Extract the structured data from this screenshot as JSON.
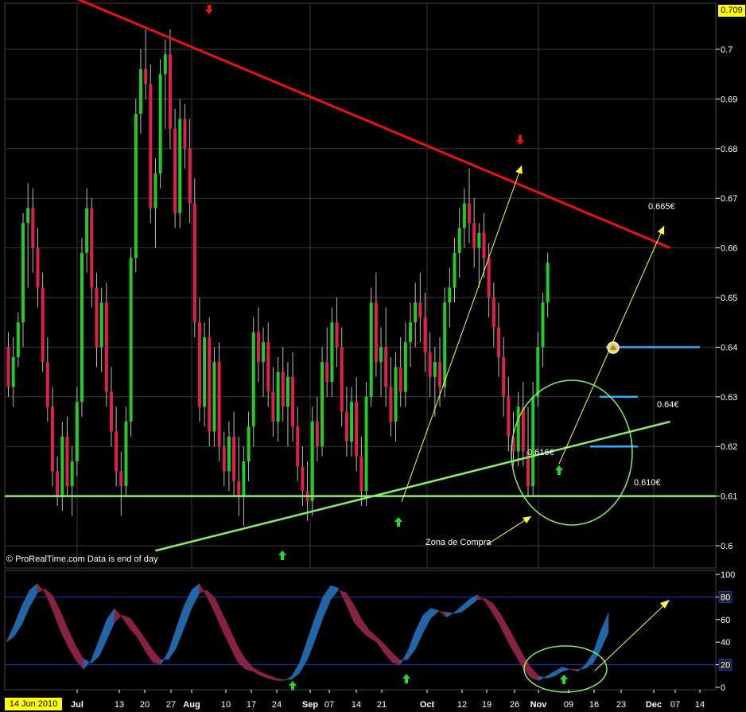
{
  "watermark": "© ProRealTime.com  Data is end of day",
  "last_price_badge": "0.709",
  "start_date_badge": "14 Jun 2010",
  "colors": {
    "background": "#000000",
    "up_candle": "#22cc22",
    "down_candle": "#e0204a",
    "resistance_line": "#ee1111",
    "support_line": "#88ee66",
    "projection_arrow": "#ffff33",
    "level_marker": "#33aaff",
    "green_arrow": "#22dd22",
    "red_arrow": "#ee1111",
    "badge_yellow": "#ffff00",
    "badge_green": "#00ff66",
    "osc_blue": "#2266aa",
    "osc_maroon": "#882244"
  },
  "annotations": {
    "target_price": "0.665€",
    "level_064": "0.64€",
    "level_0616": "0.616€",
    "level_0610": "0.610€",
    "buy_zone": "Zona de Compra"
  },
  "chart_data": [
    {
      "type": "candlestick",
      "title": "",
      "ylim": [
        0.597,
        0.712
      ],
      "y_ticks": [
        "0.6",
        "0.61",
        "0.62",
        "0.63",
        "0.64",
        "0.65",
        "0.66",
        "0.67",
        "0.68",
        "0.69",
        "0.7"
      ],
      "x_ticks": [
        "Jul",
        "13",
        "20",
        "27",
        "Aug",
        "10",
        "17",
        "24",
        "Sep",
        "07",
        "14",
        "21",
        "Oct",
        "12",
        "19",
        "26",
        "Nov",
        "09",
        "16",
        "23",
        "Dec",
        "07",
        "14"
      ],
      "grid": true,
      "series": [
        {
          "name": "",
          "period": "Jun 14 – Jul 02",
          "ohlc": [
            [
              0.64,
              0.643,
              0.63,
              0.632
            ],
            [
              0.632,
              0.642,
              0.628,
              0.638
            ],
            [
              0.638,
              0.647,
              0.636,
              0.645
            ],
            [
              0.645,
              0.667,
              0.64,
              0.665
            ],
            [
              0.665,
              0.673,
              0.652,
              0.668
            ],
            [
              0.668,
              0.672,
              0.655,
              0.66
            ],
            [
              0.66,
              0.664,
              0.648,
              0.652
            ],
            [
              0.652,
              0.655,
              0.635,
              0.637
            ],
            [
              0.637,
              0.642,
              0.625,
              0.628
            ],
            [
              0.628,
              0.632,
              0.612,
              0.615
            ],
            [
              0.615,
              0.618,
              0.608,
              0.61
            ],
            [
              0.61,
              0.625,
              0.607,
              0.622
            ],
            [
              0.622,
              0.626,
              0.61,
              0.612
            ],
            [
              0.612,
              0.62,
              0.606,
              0.617
            ],
            [
              0.617,
              0.632,
              0.614,
              0.629
            ]
          ]
        },
        {
          "name": "",
          "period": "Jul 05 – Jul 30",
          "ohlc": [
            [
              0.629,
              0.662,
              0.626,
              0.659
            ],
            [
              0.659,
              0.672,
              0.655,
              0.668
            ],
            [
              0.668,
              0.67,
              0.648,
              0.652
            ],
            [
              0.652,
              0.655,
              0.636,
              0.64
            ],
            [
              0.64,
              0.652,
              0.635,
              0.649
            ],
            [
              0.649,
              0.653,
              0.628,
              0.631
            ],
            [
              0.631,
              0.636,
              0.62,
              0.623
            ],
            [
              0.623,
              0.628,
              0.612,
              0.615
            ],
            [
              0.615,
              0.619,
              0.606,
              0.612
            ],
            [
              0.612,
              0.628,
              0.61,
              0.625
            ],
            [
              0.625,
              0.66,
              0.622,
              0.658
            ],
            [
              0.658,
              0.69,
              0.655,
              0.687
            ],
            [
              0.687,
              0.7,
              0.683,
              0.696
            ],
            [
              0.696,
              0.704,
              0.69,
              0.693
            ],
            [
              0.693,
              0.697,
              0.665,
              0.668
            ],
            [
              0.668,
              0.678,
              0.66,
              0.675
            ],
            [
              0.675,
              0.698,
              0.672,
              0.695
            ],
            [
              0.695,
              0.702,
              0.684,
              0.699
            ],
            [
              0.699,
              0.704,
              0.68,
              0.684
            ],
            [
              0.684,
              0.688,
              0.664,
              0.667
            ]
          ]
        },
        {
          "name": "",
          "period": "Aug 02 – Aug 27",
          "ohlc": [
            [
              0.667,
              0.69,
              0.664,
              0.686
            ],
            [
              0.686,
              0.689,
              0.676,
              0.68
            ],
            [
              0.68,
              0.686,
              0.665,
              0.669
            ],
            [
              0.669,
              0.674,
              0.642,
              0.645
            ],
            [
              0.645,
              0.65,
              0.625,
              0.628
            ],
            [
              0.628,
              0.645,
              0.624,
              0.642
            ],
            [
              0.642,
              0.646,
              0.62,
              0.623
            ],
            [
              0.623,
              0.64,
              0.62,
              0.637
            ],
            [
              0.637,
              0.641,
              0.617,
              0.62
            ],
            [
              0.62,
              0.623,
              0.612,
              0.615
            ],
            [
              0.615,
              0.625,
              0.611,
              0.622
            ],
            [
              0.622,
              0.627,
              0.61,
              0.613
            ],
            [
              0.613,
              0.622,
              0.606,
              0.61
            ],
            [
              0.61,
              0.62,
              0.604,
              0.617
            ],
            [
              0.617,
              0.627,
              0.613,
              0.624
            ],
            [
              0.624,
              0.646,
              0.62,
              0.643
            ],
            [
              0.643,
              0.648,
              0.633,
              0.637
            ],
            [
              0.637,
              0.644,
              0.63,
              0.641
            ],
            [
              0.641,
              0.645,
              0.628,
              0.631
            ],
            [
              0.631,
              0.636,
              0.622,
              0.625
            ]
          ]
        },
        {
          "name": "",
          "period": "Aug 30 – Sep 24",
          "ohlc": [
            [
              0.625,
              0.638,
              0.621,
              0.635
            ],
            [
              0.635,
              0.64,
              0.625,
              0.628
            ],
            [
              0.628,
              0.637,
              0.62,
              0.634
            ],
            [
              0.634,
              0.639,
              0.621,
              0.624
            ],
            [
              0.624,
              0.628,
              0.613,
              0.616
            ],
            [
              0.616,
              0.62,
              0.608,
              0.611
            ],
            [
              0.611,
              0.617,
              0.605,
              0.609
            ],
            [
              0.609,
              0.628,
              0.606,
              0.625
            ],
            [
              0.625,
              0.63,
              0.617,
              0.62
            ],
            [
              0.62,
              0.64,
              0.618,
              0.637
            ],
            [
              0.637,
              0.644,
              0.63,
              0.633
            ],
            [
              0.633,
              0.648,
              0.63,
              0.645
            ],
            [
              0.645,
              0.65,
              0.636,
              0.64
            ],
            [
              0.64,
              0.644,
              0.624,
              0.627
            ],
            [
              0.627,
              0.632,
              0.618,
              0.621
            ],
            [
              0.621,
              0.632,
              0.618,
              0.629
            ],
            [
              0.629,
              0.634,
              0.615,
              0.618
            ],
            [
              0.618,
              0.622,
              0.608,
              0.611
            ],
            [
              0.611,
              0.633,
              0.608,
              0.63
            ],
            [
              0.63,
              0.652,
              0.628,
              0.649
            ]
          ]
        },
        {
          "name": "",
          "period": "Sep 27 – Oct 22",
          "ohlc": [
            [
              0.649,
              0.655,
              0.634,
              0.637
            ],
            [
              0.637,
              0.644,
              0.63,
              0.64
            ],
            [
              0.64,
              0.648,
              0.628,
              0.632
            ],
            [
              0.632,
              0.638,
              0.622,
              0.625
            ],
            [
              0.625,
              0.639,
              0.621,
              0.636
            ],
            [
              0.636,
              0.642,
              0.628,
              0.631
            ],
            [
              0.631,
              0.645,
              0.628,
              0.641
            ],
            [
              0.641,
              0.649,
              0.636,
              0.645
            ],
            [
              0.645,
              0.653,
              0.64,
              0.649
            ],
            [
              0.649,
              0.655,
              0.641,
              0.646
            ],
            [
              0.646,
              0.651,
              0.635,
              0.639
            ],
            [
              0.639,
              0.643,
              0.63,
              0.634
            ],
            [
              0.634,
              0.64,
              0.626,
              0.637
            ],
            [
              0.637,
              0.642,
              0.628,
              0.632
            ],
            [
              0.632,
              0.652,
              0.63,
              0.649
            ],
            [
              0.649,
              0.656,
              0.644,
              0.652
            ],
            [
              0.652,
              0.662,
              0.649,
              0.659
            ],
            [
              0.659,
              0.668,
              0.654,
              0.664
            ],
            [
              0.664,
              0.672,
              0.66,
              0.669
            ],
            [
              0.669,
              0.676,
              0.661,
              0.665
            ]
          ]
        },
        {
          "name": "",
          "period": "Oct 25 – Nov 19",
          "ohlc": [
            [
              0.665,
              0.67,
              0.656,
              0.66
            ],
            [
              0.66,
              0.665,
              0.652,
              0.663
            ],
            [
              0.663,
              0.667,
              0.654,
              0.658
            ],
            [
              0.658,
              0.661,
              0.646,
              0.65
            ],
            [
              0.65,
              0.653,
              0.64,
              0.644
            ],
            [
              0.644,
              0.649,
              0.634,
              0.638
            ],
            [
              0.638,
              0.642,
              0.626,
              0.63
            ],
            [
              0.63,
              0.634,
              0.619,
              0.622
            ],
            [
              0.622,
              0.627,
              0.616,
              0.619
            ],
            [
              0.619,
              0.631,
              0.616,
              0.628
            ],
            [
              0.628,
              0.633,
              0.616,
              0.619
            ],
            [
              0.619,
              0.628,
              0.61,
              0.612
            ],
            [
              0.612,
              0.633,
              0.61,
              0.63
            ],
            [
              0.63,
              0.643,
              0.628,
              0.64
            ],
            [
              0.64,
              0.651,
              0.636,
              0.649
            ],
            [
              0.649,
              0.659,
              0.646,
              0.657
            ]
          ]
        }
      ],
      "lines": [
        {
          "kind": "resistance",
          "from": [
            "2010-06-30",
            0.711
          ],
          "to": [
            "2010-12-20",
            0.66
          ]
        },
        {
          "kind": "support_horizontal",
          "y": 0.61
        },
        {
          "kind": "support_trend",
          "from": [
            "2010-07-26",
            0.599
          ],
          "to": [
            "2010-12-20",
            0.625
          ]
        }
      ],
      "levels": [
        0.64,
        0.63,
        0.62
      ],
      "signals": {
        "buy": [
          "2010-08-27",
          "2010-09-29",
          "2010-11-05"
        ],
        "sell": [
          "2010-08-04",
          "2010-10-26"
        ]
      }
    },
    {
      "type": "area",
      "title": "",
      "ylim": [
        -4,
        104
      ],
      "y_ticks": [
        "0",
        "20",
        "40",
        "60",
        "80",
        "100"
      ],
      "bands": [
        20,
        80
      ],
      "series": [
        {
          "name": "",
          "values": [
            40,
            55,
            72,
            86,
            92,
            84,
            68,
            50,
            36,
            24,
            16,
            24,
            42,
            60,
            70,
            62,
            52,
            44,
            32,
            22,
            20,
            32,
            52,
            72,
            86,
            92,
            80,
            66,
            50,
            36,
            22,
            16,
            14,
            10,
            8,
            6,
            6,
            10,
            22,
            42,
            62,
            80,
            90,
            88,
            74,
            58,
            50,
            44,
            40,
            30,
            22,
            20,
            32,
            50,
            64,
            70,
            68,
            62,
            66,
            72,
            78,
            82,
            76,
            66,
            54,
            40,
            28,
            16,
            8,
            6,
            10,
            14,
            18,
            16,
            14,
            20,
            30,
            50,
            66
          ]
        }
      ]
    }
  ]
}
